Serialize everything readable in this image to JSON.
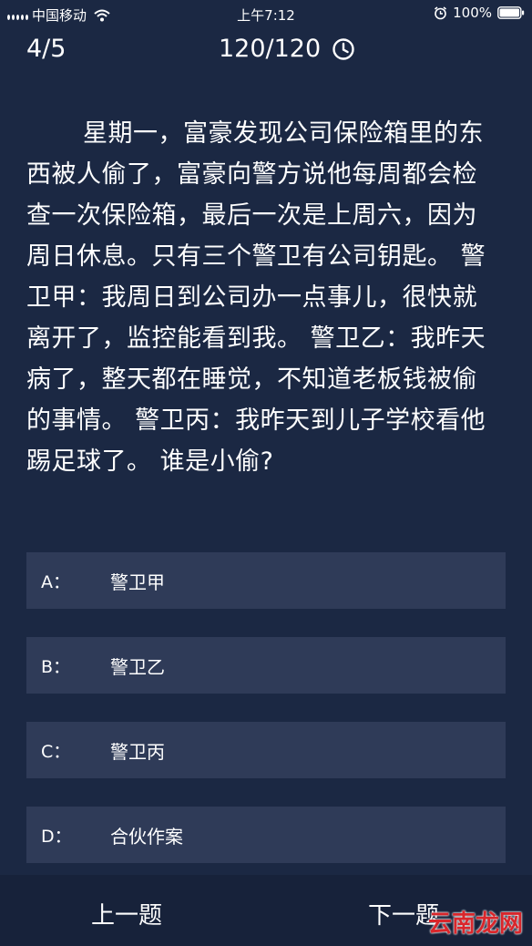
{
  "status_bar": {
    "carrier": "中国移动",
    "time": "上午7:12",
    "battery": "100%"
  },
  "header": {
    "progress": "4/5",
    "score": "120/120"
  },
  "question": {
    "text": "星期一，富豪发现公司保险箱里的东西被人偷了，富豪向警方说他每周都会检查一次保险箱，最后一次是上周六，因为周日休息。只有三个警卫有公司钥匙。 警卫甲：我周日到公司办一点事儿，很快就离开了，监控能看到我。 警卫乙：我昨天病了，整天都在睡觉，不知道老板钱被偷的事情。 警卫丙：我昨天到儿子学校看他踢足球了。 谁是小偷?"
  },
  "options": [
    {
      "letter": "A：",
      "text": "警卫甲"
    },
    {
      "letter": "B：",
      "text": "警卫乙"
    },
    {
      "letter": "C：",
      "text": "警卫丙"
    },
    {
      "letter": "D：",
      "text": "合伙作案"
    }
  ],
  "footer": {
    "prev_label": "上一题",
    "next_label": "下一题"
  },
  "watermark": "云南龙网"
}
